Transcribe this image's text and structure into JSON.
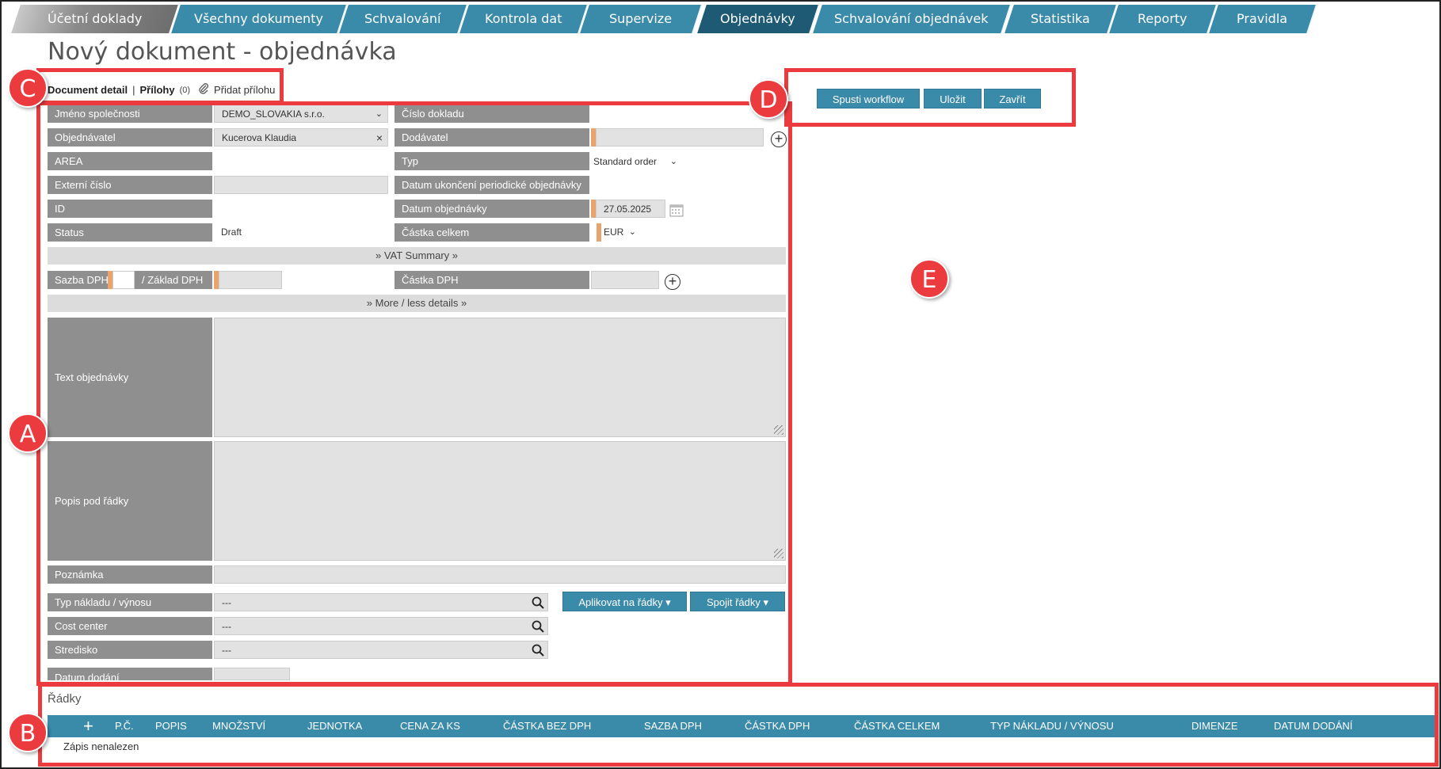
{
  "nav": {
    "tabs": [
      {
        "label": "Účetní doklady"
      },
      {
        "label": "Všechny dokumenty"
      },
      {
        "label": "Schvalování"
      },
      {
        "label": "Kontrola dat"
      },
      {
        "label": "Supervize"
      },
      {
        "label": "Objednávky"
      },
      {
        "label": "Schvalování objednávek"
      },
      {
        "label": "Statistika"
      },
      {
        "label": "Reporty"
      },
      {
        "label": "Pravidla"
      }
    ],
    "active_tab": "Objednávky"
  },
  "page_title": "Nový dokument - objednávka",
  "doclinks": {
    "detail": "Document detail",
    "separator": "|",
    "attachments": "Přílohy",
    "attachments_count": "(0)",
    "add_attachment": "Přidat přílohu"
  },
  "form": {
    "company_label": "Jméno společnosti",
    "company_value": "DEMO_SLOVAKIA s.r.o.",
    "doc_number_label": "Číslo dokladu",
    "orderer_label": "Objednávatel",
    "orderer_value": "Kucerova Klaudia",
    "clear_symbol": "×",
    "supplier_label": "Dodávatel",
    "area_label": "AREA",
    "type_label": "Typ",
    "type_value": "Standard order",
    "external_label": "Externí číslo",
    "periodic_end_label": "Datum ukončení periodické objednávky",
    "id_label": "ID",
    "order_date_label": "Datum objednávky",
    "order_date_value": "27.05.2025",
    "status_label": "Status",
    "status_value": "Draft",
    "total_label": "Částka celkem",
    "currency_value": "EUR",
    "vat_summary": "VAT Summary",
    "vat_rate_label": "Sazba DPH",
    "vat_base_label": "/ Základ DPH",
    "vat_amount_label": "Částka DPH",
    "more_details": "More / less details",
    "order_text_label": "Text objednávky",
    "lines_desc_label": "Popis pod řádky",
    "note_label": "Poznámka",
    "cost_type_label": "Typ nákladu / výnosu",
    "cost_type_value": "---",
    "cost_center_label": "Cost center",
    "cost_center_value": "---",
    "stredisko_label": "Stredisko",
    "stredisko_value": "---",
    "delivery_date_label": "Datum dodání",
    "apply_lines_button": "Aplikovat na řádky ▾",
    "merge_lines_button": "Spojit řádky ▾"
  },
  "actions": {
    "workflow": "Spusti workflow",
    "save": "Uložit",
    "close": "Zavřít"
  },
  "lines": {
    "title": "Řádky",
    "add_symbol": "+",
    "columns": [
      "P.Č.",
      "POPIS",
      "MNOŽSTVÍ",
      "JEDNOTKA",
      "CENA ZA KS",
      "ČÁSTKA BEZ DPH",
      "SAZBA DPH",
      "ČÁSTKA DPH",
      "ČÁSTKA CELKEM",
      "TYP NÁKLADU / VÝNOSU",
      "DIMENZE",
      "DATUM DODÁNÍ"
    ],
    "empty_text": "Zápis nenalezen"
  },
  "annotations": {
    "a": "A",
    "b": "B",
    "c": "C",
    "d": "D",
    "e": "E"
  },
  "colors": {
    "accent": "#3a8aaa",
    "active_tab": "#1f5a74",
    "label_bg": "#8f8f8f",
    "annotation_red": "#ec3b3f",
    "required_marker": "#e8a46c"
  }
}
